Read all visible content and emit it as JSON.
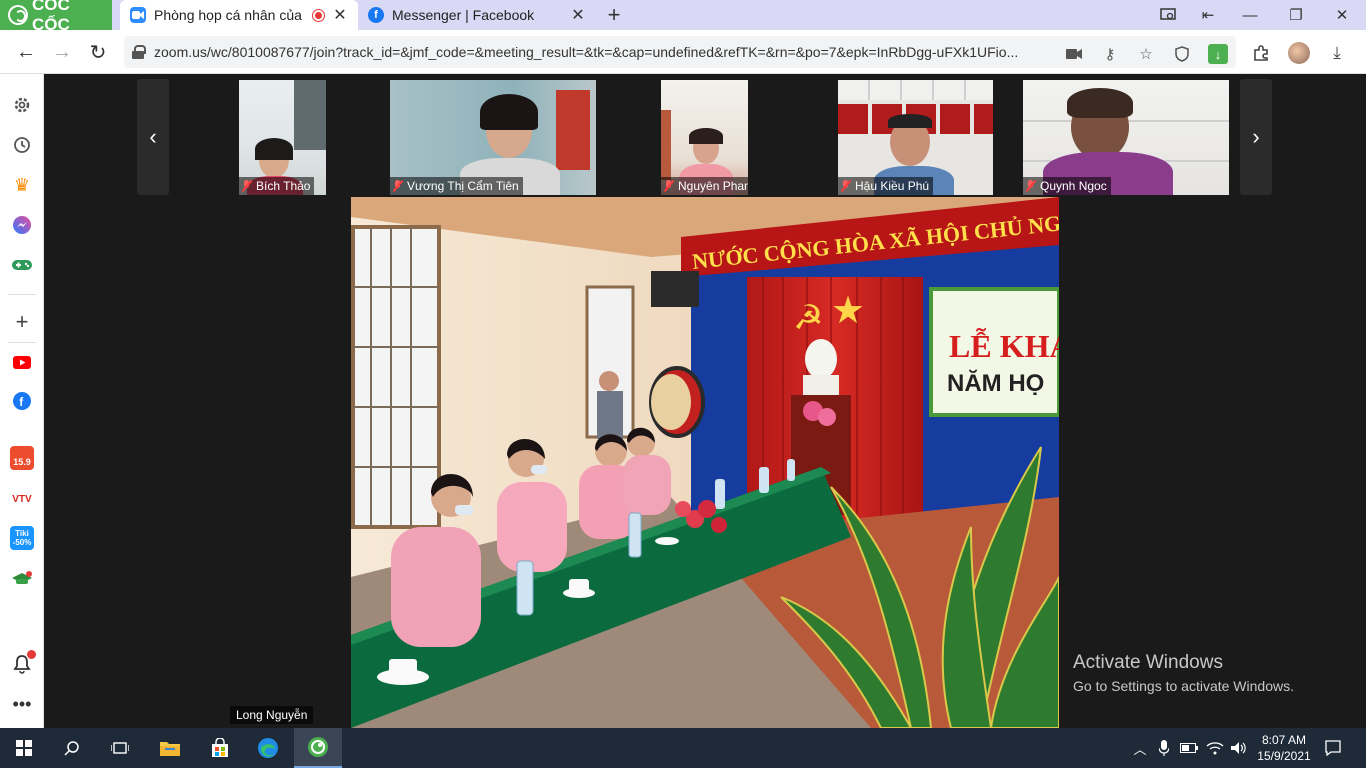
{
  "browser": {
    "brand": "CỐC CỐC",
    "tabs": [
      {
        "title": "Phòng họp cá nhân của L",
        "favicon": "zoom-icon",
        "recording": true
      },
      {
        "title": "Messenger | Facebook",
        "favicon": "facebook-icon",
        "recording": false
      }
    ],
    "url": "zoom.us/wc/8010087677/join?track_id=&jmf_code=&meeting_result=&tk=&cap=undefined&refTK=&rn=&po=7&epk=InRbDgg-uFXk1UFio..."
  },
  "sidebar": {
    "items": [
      "settings-icon",
      "history-icon",
      "crown-icon",
      "messenger-icon",
      "gamepad-icon",
      "add-icon",
      "youtube-icon",
      "facebook-icon",
      "shopee-icon",
      "vtv-go-icon",
      "tiki-icon",
      "education-icon",
      "notifications-icon",
      "more-icon"
    ],
    "shopee_label": "15.9",
    "vtv_label": "VTV",
    "tiki_label": "Tiki",
    "tiki_badge": "-50%"
  },
  "meeting": {
    "participants": [
      {
        "name": "Bích Thảo",
        "muted": true
      },
      {
        "name": "Vương Thị Cẩm Tiên",
        "muted": true
      },
      {
        "name": "Nguyên Phan Thảo",
        "muted": true
      },
      {
        "name": "Hậu Kiều Phú",
        "muted": true
      },
      {
        "name": "Quynh Ngoc",
        "muted": true
      }
    ],
    "active_speaker": "Long Nguyễn",
    "banner_text": "NƯỚC CỘNG HÒA XÃ HỘI CHỦ NGHĨA VIỆ",
    "board_title": "LỄ KHA",
    "board_subtitle": "NĂM HỌ"
  },
  "watermark": {
    "line1": "Activate Windows",
    "line2": "Go to Settings to activate Windows."
  },
  "taskbar": {
    "time": "8:07 AM",
    "date": "15/9/2021"
  },
  "colors": {
    "tabbar": "#dad9f5",
    "brand": "#4caf50",
    "taskbar": "#1f2a38",
    "meeting_bg": "#1a1a1a"
  }
}
